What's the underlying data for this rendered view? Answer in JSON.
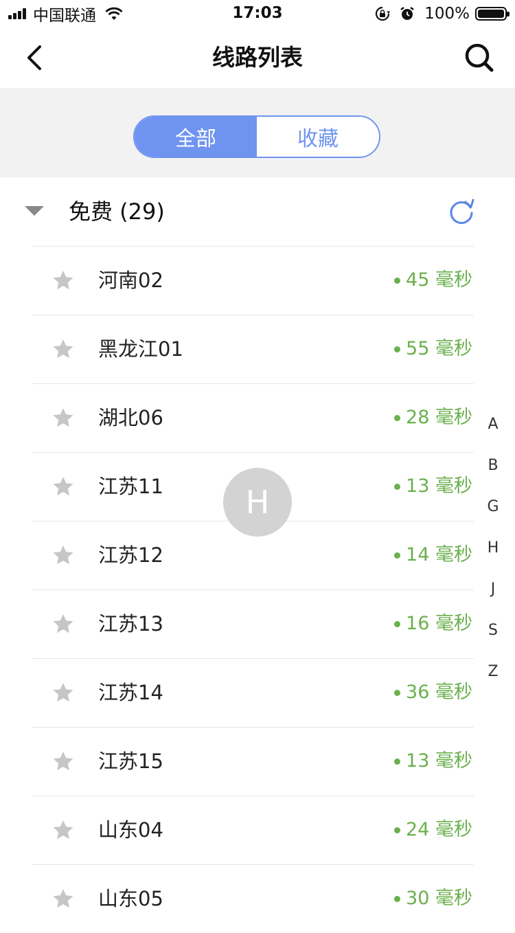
{
  "status_bar": {
    "carrier": "中国联通",
    "time": "17:03",
    "battery_percent": "100%",
    "icons": [
      "signal-icon",
      "wifi-icon",
      "rotation-lock-icon",
      "alarm-icon",
      "battery-icon"
    ]
  },
  "nav": {
    "title": "线路列表",
    "icons": [
      "back-chevron-icon",
      "search-icon"
    ]
  },
  "segments": {
    "all": "全部",
    "favorites": "收藏",
    "selected": "全部",
    "accent_color": "#6f94f0"
  },
  "section": {
    "title": "免费 (29)",
    "icons": [
      "caret-down-icon",
      "refresh-icon"
    ]
  },
  "servers": [
    {
      "name": "河南02",
      "latency": "45 毫秒"
    },
    {
      "name": "黑龙江01",
      "latency": "55 毫秒"
    },
    {
      "name": "湖北06",
      "latency": "28 毫秒"
    },
    {
      "name": "江苏11",
      "latency": "13 毫秒"
    },
    {
      "name": "江苏12",
      "latency": "14 毫秒"
    },
    {
      "name": "江苏13",
      "latency": "16 毫秒"
    },
    {
      "name": "江苏14",
      "latency": "36 毫秒"
    },
    {
      "name": "江苏15",
      "latency": "13 毫秒"
    },
    {
      "name": "山东04",
      "latency": "24 毫秒"
    },
    {
      "name": "山东05",
      "latency": "30 毫秒"
    }
  ],
  "latency_color": "#6ab04c",
  "index_letters": [
    "A",
    "B",
    "G",
    "H",
    "J",
    "S",
    "Z"
  ],
  "index_bubble": "H"
}
